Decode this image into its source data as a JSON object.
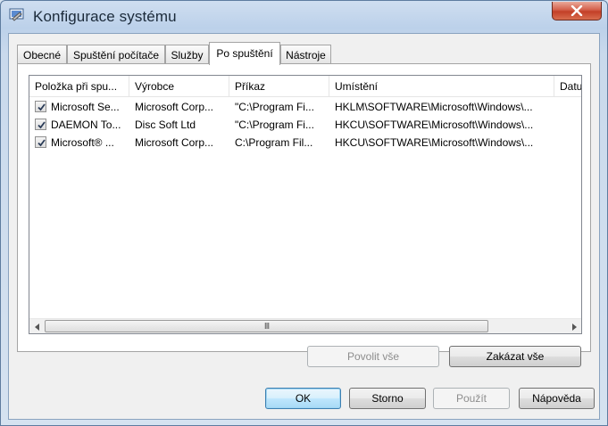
{
  "window": {
    "title": "Konfigurace systému"
  },
  "tabs": [
    {
      "label": "Obecné"
    },
    {
      "label": "Spuštění počítače"
    },
    {
      "label": "Služby"
    },
    {
      "label": "Po spuštění"
    },
    {
      "label": "Nástroje"
    }
  ],
  "active_tab": "Po spuštění",
  "startup_list": {
    "columns": [
      "Položka při spu...",
      "Výrobce",
      "Příkaz",
      "Umístění",
      "Datu"
    ],
    "rows": [
      {
        "checked": true,
        "item": "Microsoft Se...",
        "vendor": "Microsoft Corp...",
        "command": "\"C:\\Program Fi...",
        "location": "HKLM\\SOFTWARE\\Microsoft\\Windows\\..."
      },
      {
        "checked": true,
        "item": "DAEMON To...",
        "vendor": "Disc Soft Ltd",
        "command": "\"C:\\Program Fi...",
        "location": "HKCU\\SOFTWARE\\Microsoft\\Windows\\..."
      },
      {
        "checked": true,
        "item": "Microsoft® ...",
        "vendor": "Microsoft Corp...",
        "command": "C:\\Program Fil...",
        "location": "HKCU\\SOFTWARE\\Microsoft\\Windows\\..."
      }
    ],
    "scroll_grip": "III"
  },
  "panel_buttons": {
    "enable_all": "Povolit vše",
    "disable_all": "Zakázat vše"
  },
  "dialog_buttons": {
    "ok": "OK",
    "cancel": "Storno",
    "apply": "Použít",
    "help": "Nápověda"
  },
  "colors": {
    "close_button": "#c8402a",
    "default_button_border": "#3c7fb1"
  },
  "icons": [
    "system-config-icon",
    "close-icon",
    "checkmark-icon",
    "arrow-left-icon",
    "arrow-right-icon"
  ]
}
